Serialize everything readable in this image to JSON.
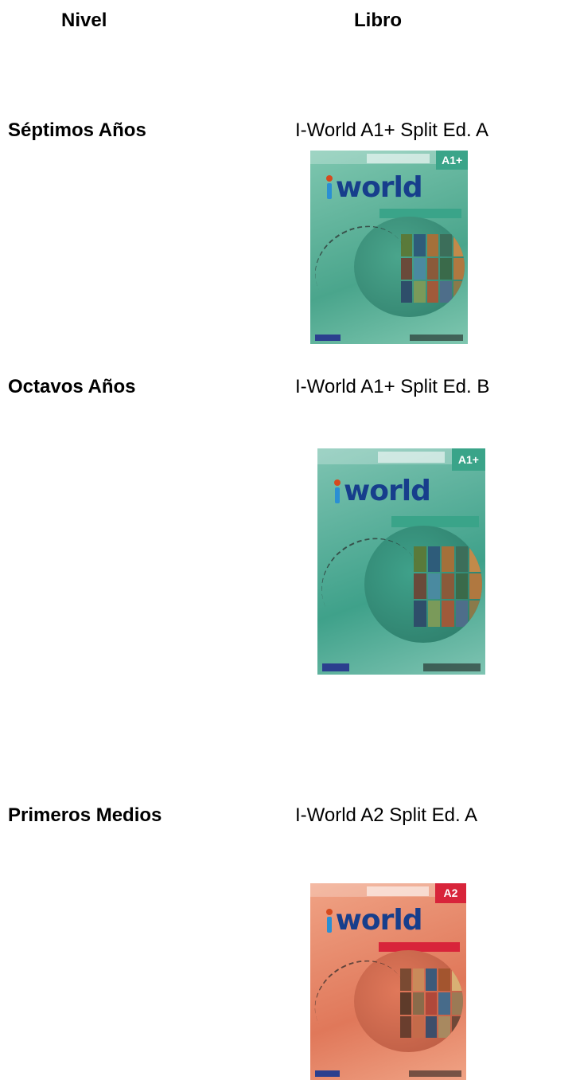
{
  "headers": {
    "level": "Nivel",
    "book": "Libro"
  },
  "rows": [
    {
      "level": "Séptimos Años",
      "book": "I-World A1+ Split Ed. A",
      "cover": {
        "tag": "A1+",
        "logo": "world",
        "theme": "teal",
        "bg": "#7fc7b0",
        "accent": "#4aa58c",
        "globe": "#2f7d6a"
      }
    },
    {
      "level": "Octavos Años",
      "book": "I-World A1+ Split Ed. B",
      "cover": {
        "tag": "A1+",
        "logo": "world",
        "theme": "teal",
        "bg": "#7fc4b2",
        "accent": "#3fa18a",
        "globe": "#2b7866"
      }
    },
    {
      "level": "Primeros Medios",
      "book": "I-World A2 Split Ed. A",
      "cover": {
        "tag": "A2",
        "logo": "world",
        "theme": "coral",
        "bg": "#f0a385",
        "accent": "#e0785a",
        "globe": "#b65840"
      }
    }
  ]
}
